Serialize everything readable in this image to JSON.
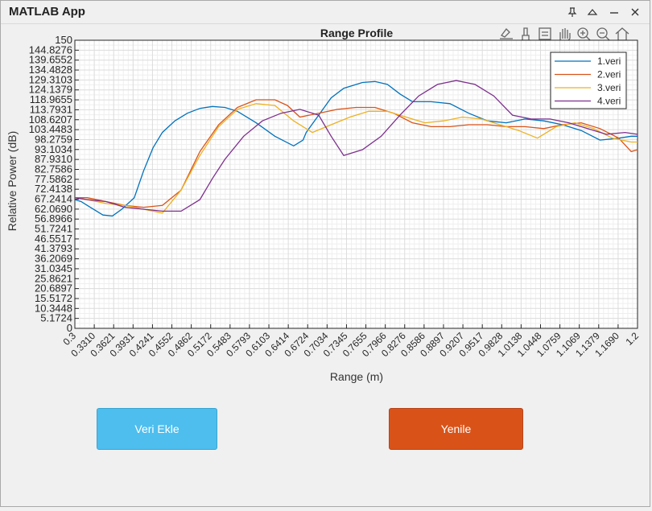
{
  "window": {
    "title": "MATLAB App",
    "controls": [
      "pin-icon",
      "collapse-icon",
      "minimize-icon",
      "close-icon"
    ]
  },
  "toolbar": {
    "icons": [
      "export-icon",
      "brush-icon",
      "data-tips-icon",
      "pan-icon",
      "zoom-in-icon",
      "zoom-out-icon",
      "home-icon"
    ]
  },
  "buttons": {
    "add_data": {
      "label": "Veri Ekle",
      "color": "#4dbeee"
    },
    "refresh": {
      "label": "Yenile",
      "color": "#d95319"
    }
  },
  "chart_data": {
    "type": "line",
    "title": "Range Profile",
    "xlabel": "Range (m)",
    "ylabel": "Relative Power (dB)",
    "xlim": [
      0.3,
      1.2
    ],
    "ylim": [
      0,
      150
    ],
    "grid": true,
    "legend_position": "top-right",
    "x_ticks": [
      "0.3",
      "0.3310",
      "0.3621",
      "0.3931",
      "0.4241",
      "0.4552",
      "0.4862",
      "0.5172",
      "0.5483",
      "0.5793",
      "0.6103",
      "0.6414",
      "0.6724",
      "0.7034",
      "0.7345",
      "0.7655",
      "0.7966",
      "0.8276",
      "0.8586",
      "0.8897",
      "0.9207",
      "0.9517",
      "0.9828",
      "1.0138",
      "1.0448",
      "1.0759",
      "1.1069",
      "1.1379",
      "1.1690",
      "1.2"
    ],
    "y_ticks": [
      "0",
      "5.1724",
      "10.3448",
      "15.5172",
      "20.6897",
      "25.8621",
      "31.0345",
      "36.2069",
      "41.3793",
      "46.5517",
      "51.7241",
      "56.8966",
      "62.0690",
      "67.2414",
      "72.4138",
      "77.5862",
      "82.7586",
      "87.9310",
      "93.1034",
      "98.2759",
      "103.4483",
      "108.6207",
      "113.7931",
      "118.9655",
      "124.1379",
      "129.3103",
      "134.4828",
      "139.6552",
      "144.8276",
      "150"
    ],
    "series": [
      {
        "name": "1.veri",
        "color": "#0072bd",
        "x": [
          0.3,
          0.31,
          0.32,
          0.345,
          0.36,
          0.375,
          0.395,
          0.41,
          0.425,
          0.44,
          0.46,
          0.48,
          0.5,
          0.52,
          0.54,
          0.56,
          0.59,
          0.62,
          0.65,
          0.665,
          0.67,
          0.69,
          0.71,
          0.73,
          0.76,
          0.78,
          0.8,
          0.82,
          0.84,
          0.87,
          0.9,
          0.93,
          0.96,
          0.99,
          1.02,
          1.05,
          1.08,
          1.11,
          1.14,
          1.17,
          1.19,
          1.2
        ],
        "y": [
          67,
          66,
          64,
          59,
          58.5,
          62,
          68,
          82,
          94,
          102,
          108,
          112,
          114.5,
          115.5,
          115,
          113,
          107,
          100,
          95,
          98,
          102,
          111,
          120,
          125,
          128,
          128.5,
          127,
          122,
          118,
          118,
          117,
          112,
          108,
          107,
          109,
          108,
          106,
          103,
          98,
          99,
          100,
          100
        ]
      },
      {
        "name": "2.veri",
        "color": "#d95319",
        "x": [
          0.3,
          0.32,
          0.35,
          0.38,
          0.41,
          0.44,
          0.47,
          0.5,
          0.53,
          0.56,
          0.59,
          0.62,
          0.64,
          0.66,
          0.69,
          0.72,
          0.75,
          0.78,
          0.81,
          0.84,
          0.87,
          0.9,
          0.93,
          0.96,
          0.99,
          1.02,
          1.05,
          1.08,
          1.11,
          1.14,
          1.17,
          1.19,
          1.2
        ],
        "y": [
          68,
          68,
          66,
          64,
          63,
          64,
          72,
          92,
          106,
          115,
          119,
          119,
          116,
          110,
          112,
          114,
          115,
          115,
          112,
          107,
          105,
          105,
          106,
          106,
          105,
          105,
          104,
          106,
          107,
          104,
          99,
          92,
          93
        ]
      },
      {
        "name": "3.veri",
        "color": "#edb120",
        "x": [
          0.3,
          0.32,
          0.35,
          0.38,
          0.41,
          0.44,
          0.47,
          0.5,
          0.53,
          0.56,
          0.59,
          0.62,
          0.65,
          0.68,
          0.71,
          0.74,
          0.77,
          0.8,
          0.83,
          0.86,
          0.89,
          0.92,
          0.95,
          0.98,
          1.01,
          1.04,
          1.07,
          1.1,
          1.13,
          1.16,
          1.19,
          1.2
        ],
        "y": [
          68,
          67,
          65,
          64,
          62,
          60,
          72,
          90,
          105,
          114,
          117,
          116,
          108,
          102,
          106,
          110,
          113,
          113,
          110,
          107,
          108,
          110,
          109,
          106,
          103,
          99,
          105,
          107,
          104,
          99,
          97,
          97
        ]
      },
      {
        "name": "4.veri",
        "color": "#7e2f8e",
        "x": [
          0.3,
          0.32,
          0.35,
          0.38,
          0.41,
          0.44,
          0.47,
          0.5,
          0.52,
          0.54,
          0.57,
          0.6,
          0.63,
          0.66,
          0.69,
          0.71,
          0.73,
          0.76,
          0.79,
          0.82,
          0.85,
          0.88,
          0.91,
          0.94,
          0.97,
          1.0,
          1.03,
          1.06,
          1.09,
          1.12,
          1.15,
          1.18,
          1.2
        ],
        "y": [
          68,
          67,
          66,
          63,
          62,
          61,
          61,
          67,
          78,
          88,
          100,
          108,
          112,
          114,
          111,
          100,
          90,
          93,
          100,
          111,
          121,
          127,
          129,
          127,
          121,
          111,
          109,
          109,
          107,
          104,
          101,
          102,
          101
        ]
      }
    ]
  }
}
